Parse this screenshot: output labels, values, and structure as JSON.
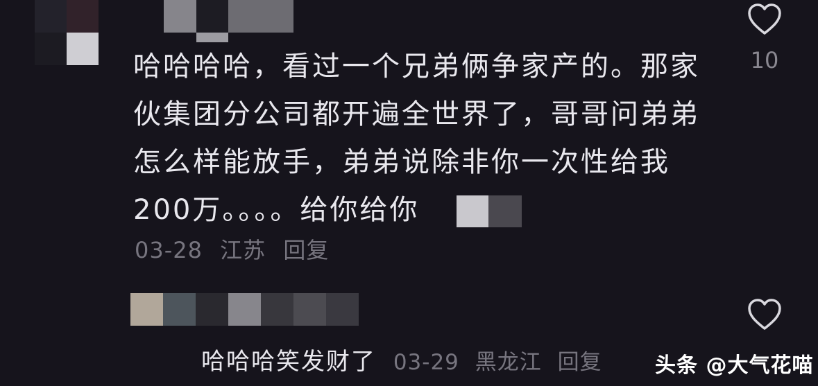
{
  "comment1": {
    "lines": [
      "哈哈哈哈，看过一个兄弟俩争家产的。那家",
      "伙集团分公司都开遍全世界了，哥哥问弟弟",
      "怎么样能放手，弟弟说除非你一次性给我",
      "200万。。。。给你给你"
    ],
    "date": "03-28",
    "location": "江苏",
    "reply_label": "回复",
    "like_count": "10"
  },
  "comment2": {
    "text": "哈哈哈笑发财了",
    "date": "03-29",
    "location": "黑龙江",
    "reply_label": "回复"
  },
  "watermark": "头条 @大气花喵",
  "icons": {
    "like": "heart-icon"
  },
  "colors": {
    "background": "#16141c",
    "text_primary": "#e9e8ee",
    "text_secondary": "#77757f"
  }
}
